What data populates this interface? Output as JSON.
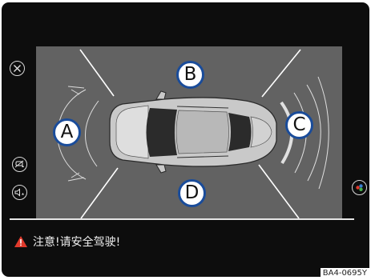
{
  "zones": {
    "a": "A",
    "b": "B",
    "c": "C",
    "d": "D"
  },
  "warning": {
    "text": "注意!请安全驾驶!",
    "icon": "warning-triangle-icon",
    "icon_color": "#e03a2c"
  },
  "figure_code": "BA4-0695Y",
  "side_buttons": {
    "close": "close-icon",
    "left_1": "parking-assist-icon",
    "left_2": "sound-icon",
    "right": "camera-view-icon"
  },
  "colors": {
    "panel": "#626262",
    "badge_ring": "#1a4c9a",
    "screen": "#0d0d0d"
  }
}
